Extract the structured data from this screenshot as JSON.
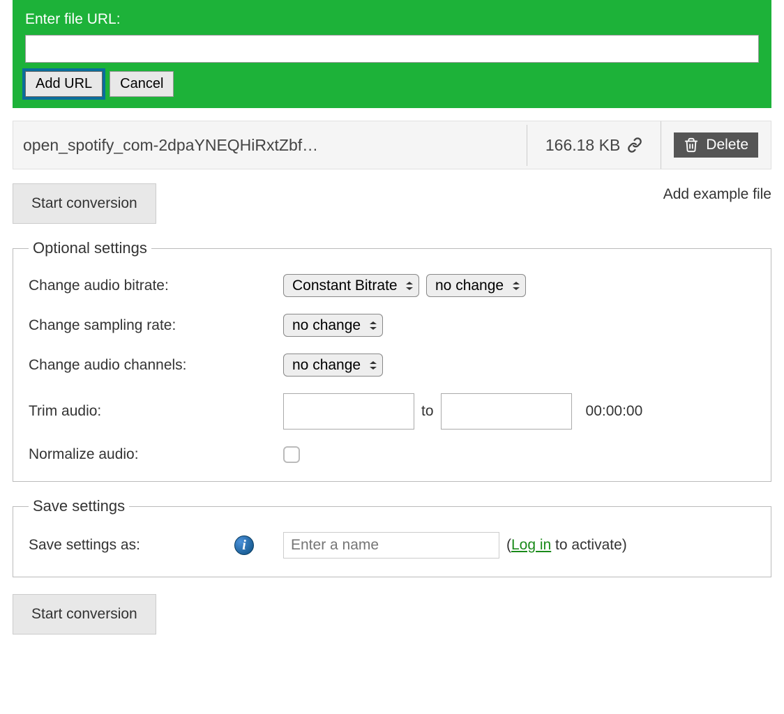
{
  "url_section": {
    "label": "Enter file URL:",
    "add_button": "Add URL",
    "cancel_button": "Cancel"
  },
  "file": {
    "name": "open_spotify_com-2dpaYNEQHiRxtZbf…",
    "size": "166.18 KB",
    "delete_label": "Delete"
  },
  "actions": {
    "start": "Start conversion",
    "add_example": "Add example file"
  },
  "optional": {
    "legend": "Optional settings",
    "bitrate": {
      "label": "Change audio bitrate:",
      "mode": "Constant Bitrate",
      "value": "no change"
    },
    "sampling": {
      "label": "Change sampling rate:",
      "value": "no change"
    },
    "channels": {
      "label": "Change audio channels:",
      "value": "no change"
    },
    "trim": {
      "label": "Trim audio:",
      "to": "to",
      "duration": "00:00:00"
    },
    "normalize": {
      "label": "Normalize audio:"
    }
  },
  "save": {
    "legend": "Save settings",
    "label": "Save settings as:",
    "placeholder": "Enter a name",
    "login_pre": "(",
    "login_text": "Log in",
    "login_post": " to activate)"
  }
}
